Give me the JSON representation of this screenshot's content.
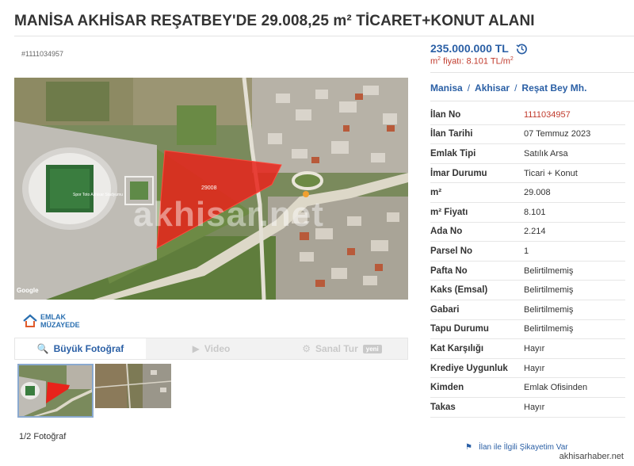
{
  "title": "MANİSA AKHİSAR REŞATBEY'DE 29.008,25 m² TİCARET+KONUT ALANI",
  "listing_ref": "#1111034957",
  "price": "235.000.000 TL",
  "m2_price_label": "m",
  "m2_price_value": " fiyatı: 8.101 TL/m",
  "breadcrumb": [
    "Manisa",
    "Akhisar",
    "Reşat Bey Mh."
  ],
  "breadcrumb_sep": "/",
  "watermark": "akhisar.net",
  "google_label": "Google",
  "photo_plot_label": "29008",
  "stadium_label": "Spor Toto Akhisar Stadyumu",
  "logo": {
    "line1": "EMLAK",
    "line2": "MÜZAYEDE"
  },
  "media_tabs": [
    {
      "label": "Büyük Fotoğraf",
      "icon": "search-icon",
      "active": true
    },
    {
      "label": "Video",
      "icon": "play-icon",
      "active": false
    },
    {
      "label": "Sanal Tur",
      "icon": "cube-icon",
      "active": false,
      "badge": "yeni"
    }
  ],
  "photo_count": "1/2 Fotoğraf",
  "info": [
    {
      "label": "İlan No",
      "value": "1111034957",
      "highlight": true
    },
    {
      "label": "İlan Tarihi",
      "value": "07 Temmuz 2023"
    },
    {
      "label": "Emlak Tipi",
      "value": "Satılık Arsa"
    },
    {
      "label": "İmar Durumu",
      "value": "Ticari + Konut"
    },
    {
      "label": "m²",
      "value": "29.008"
    },
    {
      "label": "m² Fiyatı",
      "value": "8.101"
    },
    {
      "label": "Ada No",
      "value": "2.214"
    },
    {
      "label": "Parsel No",
      "value": "1"
    },
    {
      "label": "Pafta No",
      "value": "Belirtilmemiş"
    },
    {
      "label": "Kaks (Emsal)",
      "value": "Belirtilmemiş"
    },
    {
      "label": "Gabari",
      "value": "Belirtilmemiş"
    },
    {
      "label": "Tapu Durumu",
      "value": "Belirtilmemiş"
    },
    {
      "label": "Kat Karşılığı",
      "value": "Hayır"
    },
    {
      "label": "Krediye Uygunluk",
      "value": "Hayır"
    },
    {
      "label": "Kimden",
      "value": "Emlak Ofisinden"
    },
    {
      "label": "Takas",
      "value": "Hayır"
    }
  ],
  "complaint_link": "İlan ile İlgili Şikayetim Var",
  "site_tag": "akhisarhaber.net",
  "colors": {
    "accent": "#2a5fa5",
    "price_red": "#c0392b",
    "plot_red": "#e8231b"
  }
}
